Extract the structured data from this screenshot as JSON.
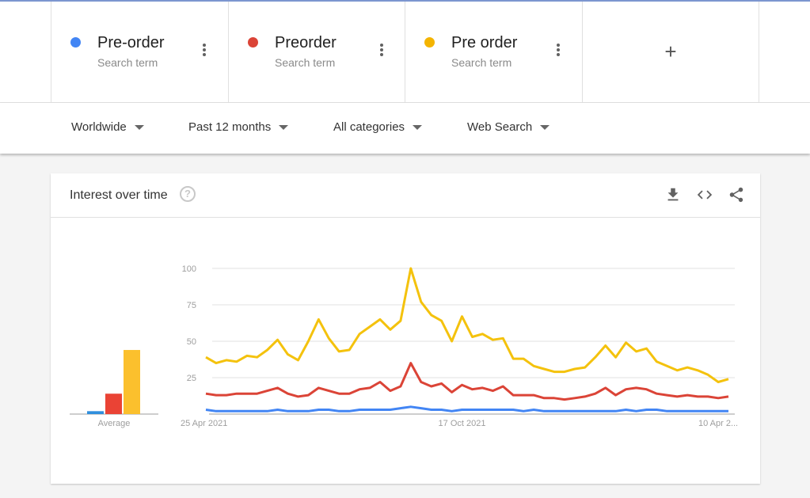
{
  "search_terms": [
    {
      "name": "Pre-order",
      "sub": "Search term",
      "color": "#4285f4"
    },
    {
      "name": "Preorder",
      "sub": "Search term",
      "color": "#db4437"
    },
    {
      "name": "Pre order",
      "sub": "Search term",
      "color": "#f4b400"
    }
  ],
  "add_term_label": "+",
  "filters": {
    "region": "Worldwide",
    "time": "Past 12 months",
    "category": "All categories",
    "search_type": "Web Search"
  },
  "card": {
    "title": "Interest over time",
    "help_label": "?"
  },
  "chart_data": {
    "type": "line",
    "title": "Interest over time",
    "ylim": [
      0,
      100
    ],
    "yticks": [
      25,
      50,
      75,
      100
    ],
    "grid": true,
    "xtick_labels": [
      {
        "index": 0,
        "label": "25 Apr 2021"
      },
      {
        "index": 25,
        "label": "17 Oct 2021"
      },
      {
        "index": 50,
        "label": "10 Apr 2..."
      }
    ],
    "average_label": "Average",
    "averages": [
      {
        "name": "Pre-order",
        "value": 2
      },
      {
        "name": "Preorder",
        "value": 14
      },
      {
        "name": "Pre order",
        "value": 44
      }
    ],
    "series": [
      {
        "name": "Pre-order",
        "color": "#4285f4",
        "values": [
          3,
          2,
          2,
          2,
          2,
          2,
          2,
          3,
          2,
          2,
          2,
          3,
          3,
          2,
          2,
          3,
          3,
          3,
          3,
          4,
          5,
          4,
          3,
          3,
          2,
          3,
          3,
          3,
          3,
          3,
          3,
          2,
          3,
          2,
          2,
          2,
          2,
          2,
          2,
          2,
          2,
          3,
          2,
          3,
          3,
          2,
          2,
          2,
          2,
          2,
          2,
          2
        ]
      },
      {
        "name": "Preorder",
        "color": "#db4437",
        "values": [
          14,
          13,
          13,
          14,
          14,
          14,
          16,
          18,
          14,
          12,
          13,
          18,
          16,
          14,
          14,
          17,
          18,
          22,
          16,
          19,
          35,
          22,
          19,
          21,
          15,
          20,
          17,
          18,
          16,
          19,
          13,
          13,
          13,
          11,
          11,
          10,
          11,
          12,
          14,
          18,
          13,
          17,
          18,
          17,
          14,
          13,
          12,
          13,
          12,
          12,
          11,
          12
        ]
      },
      {
        "name": "Pre order",
        "color": "#f4c20d",
        "values": [
          39,
          35,
          37,
          36,
          40,
          39,
          44,
          51,
          41,
          37,
          50,
          65,
          52,
          43,
          44,
          55,
          60,
          65,
          58,
          64,
          100,
          77,
          68,
          64,
          50,
          67,
          53,
          55,
          51,
          52,
          38,
          38,
          33,
          31,
          29,
          29,
          31,
          32,
          39,
          47,
          39,
          49,
          43,
          45,
          36,
          33,
          30,
          32,
          30,
          27,
          22,
          24
        ]
      }
    ]
  }
}
